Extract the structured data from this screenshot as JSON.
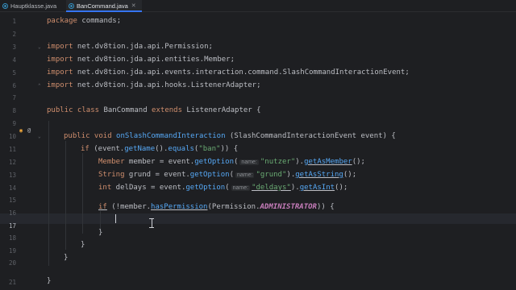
{
  "tabs": [
    {
      "label": "Hauptklasse.java",
      "active": false
    },
    {
      "label": "BanCommand.java",
      "active": true
    }
  ],
  "line_numbers": [
    "1",
    "2",
    "3",
    "4",
    "5",
    "6",
    "7",
    "8",
    "9",
    "10",
    "11",
    "12",
    "13",
    "14",
    "15",
    "16",
    "17",
    "18",
    "19",
    "20",
    "21"
  ],
  "code": {
    "l1_kw": "package",
    "l1_rest": " commands;",
    "import_kw": "import",
    "l3": " net.dv8tion.jda.api.Permission;",
    "l4": " net.dv8tion.jda.api.entities.Member;",
    "l5": " net.dv8tion.jda.api.events.interaction.command.SlashCommandInteractionEvent;",
    "l6": " net.dv8tion.jda.api.hooks.ListenerAdapter;",
    "l8_public": "public",
    "l8_class": " class",
    "l8_name": " BanCommand",
    "l8_extends": " extends",
    "l8_rest": " ListenerAdapter {",
    "l10_public": "public",
    "l10_void": " void",
    "l10_fn": " onSlashCommandInteraction",
    "l10_rest": " (SlashCommandInteractionEvent event) {",
    "l11_if": "if",
    "l11_a": " (event.",
    "l11_fn": "getName",
    "l11_b": "().",
    "l11_fn2": "equals",
    "l11_c": "(",
    "l11_str": "\"ban\"",
    "l11_d": ")) {",
    "l12_type": "Member",
    "l12_a": " member = event.",
    "l12_fn": "getOption",
    "l12_b": "(",
    "l12_hint": "name:",
    "l12_str": "\"nutzer\"",
    "l12_c": ").",
    "l12_fn2": "getAsMember",
    "l12_d": "();",
    "l13_type": "String",
    "l13_a": " grund = event.",
    "l13_fn": "getOption",
    "l13_b": "(",
    "l13_hint": "name:",
    "l13_str": "\"grund\"",
    "l13_c": ").",
    "l13_fn2": "getAsString",
    "l13_d": "();",
    "l14_type": "int",
    "l14_a": " delDays = event.",
    "l14_fn": "getOption",
    "l14_b": "(",
    "l14_hint": "name:",
    "l14_str": "\"deldays\"",
    "l14_c": ").",
    "l14_fn2": "getAsInt",
    "l14_d": "();",
    "l16_if": "if",
    "l16_a": " (!member.",
    "l16_fn": "hasPermission",
    "l16_b": "(Permission.",
    "l16_const": "ADMINISTRATOR",
    "l16_c": ")) {",
    "brace": "}"
  },
  "colors": {
    "background": "#1e1f22",
    "keyword": "#cf8e6d",
    "method": "#56a8f5",
    "string": "#6aab73",
    "constant": "#c77dbb",
    "text": "#bcbec4"
  },
  "gutter_icons": [
    "override-icon",
    "annotation-icon"
  ]
}
